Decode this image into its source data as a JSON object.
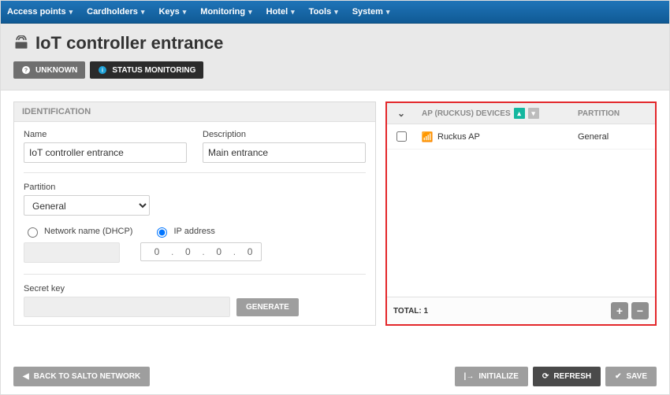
{
  "menubar": [
    "Access points",
    "Cardholders",
    "Keys",
    "Monitoring",
    "Hotel",
    "Tools",
    "System"
  ],
  "page_title": "IoT controller entrance",
  "status_badges": {
    "unknown": "UNKNOWN",
    "monitoring": "STATUS MONITORING"
  },
  "identification": {
    "section_label": "IDENTIFICATION",
    "name_label": "Name",
    "name_value": "IoT controller entrance",
    "desc_label": "Description",
    "desc_value": "Main entrance",
    "partition_label": "Partition",
    "partition_value": "General",
    "net_dhcp_label": "Network name (DHCP)",
    "ip_label": "IP address",
    "ip_octets": [
      "0",
      "0",
      "0",
      "0"
    ],
    "secret_label": "Secret key",
    "generate_label": "GENERATE"
  },
  "devices": {
    "col_devices": "AP (RUCKUS) DEVICES",
    "col_partition": "PARTITION",
    "rows": [
      {
        "name": "Ruckus AP",
        "partition": "General"
      }
    ],
    "total_label": "TOTAL:",
    "total_value": "1"
  },
  "actions": {
    "back": "BACK TO SALTO NETWORK",
    "initialize": "INITIALIZE",
    "refresh": "REFRESH",
    "save": "SAVE"
  }
}
